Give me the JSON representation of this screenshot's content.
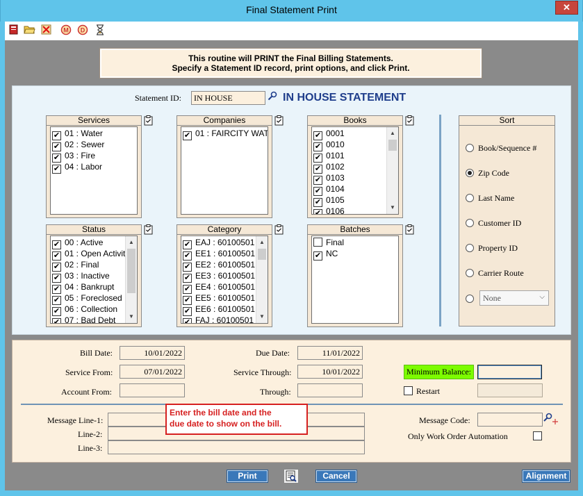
{
  "window": {
    "title": "Final Statement Print",
    "close_label": "✕"
  },
  "toolbar": {
    "icons": [
      "print-icon",
      "open-folder-icon",
      "delete-icon",
      "m-circle-icon",
      "d-circle-icon",
      "hourglass-icon"
    ]
  },
  "info": {
    "line1": "This routine will PRINT the Final Billing Statements.",
    "line2": "Specify a Statement ID record, print options, and click Print."
  },
  "statement": {
    "label": "Statement ID:",
    "value": "IN HOUSE",
    "description": "IN HOUSE STATEMENT"
  },
  "services": {
    "title": "Services",
    "items": [
      {
        "label": "01 : Water",
        "checked": true
      },
      {
        "label": "02 : Sewer",
        "checked": true
      },
      {
        "label": "03 : Fire",
        "checked": true
      },
      {
        "label": "04 : Labor",
        "checked": true
      }
    ]
  },
  "companies": {
    "title": "Companies",
    "items": [
      {
        "label": "01 : FAIRCITY WAT",
        "checked": true
      }
    ]
  },
  "books": {
    "title": "Books",
    "items": [
      {
        "label": "0001",
        "checked": true
      },
      {
        "label": "0010",
        "checked": true
      },
      {
        "label": "0101",
        "checked": true
      },
      {
        "label": "0102",
        "checked": true
      },
      {
        "label": "0103",
        "checked": true
      },
      {
        "label": "0104",
        "checked": true
      },
      {
        "label": "0105",
        "checked": true
      },
      {
        "label": "0106",
        "checked": true
      }
    ]
  },
  "status": {
    "title": "Status",
    "items": [
      {
        "label": "00 : Active",
        "checked": true
      },
      {
        "label": "01 : Open Activit",
        "checked": true
      },
      {
        "label": "02 : Final",
        "checked": true
      },
      {
        "label": "03 : Inactive",
        "checked": true
      },
      {
        "label": "04 : Bankrupt",
        "checked": true
      },
      {
        "label": "05 : Foreclosed",
        "checked": true
      },
      {
        "label": "06 : Collection",
        "checked": true
      },
      {
        "label": "07 : Bad Debt",
        "checked": true
      }
    ]
  },
  "category": {
    "title": "Category",
    "items": [
      {
        "label": "EAJ : 60100501",
        "checked": true
      },
      {
        "label": "EE1 : 60100501",
        "checked": true
      },
      {
        "label": "EE2 : 60100501",
        "checked": true
      },
      {
        "label": "EE3 : 60100501",
        "checked": true
      },
      {
        "label": "EE4 : 60100501",
        "checked": true
      },
      {
        "label": "EE5 : 60100501",
        "checked": true
      },
      {
        "label": "EE6 : 60100501",
        "checked": true
      },
      {
        "label": "FAJ : 60100501",
        "checked": true
      }
    ]
  },
  "batches": {
    "title": "Batches",
    "items": [
      {
        "label": "Final",
        "checked": false
      },
      {
        "label": "NC",
        "checked": true
      }
    ]
  },
  "sort": {
    "title": "Sort",
    "options": [
      {
        "label": "Book/Sequence #",
        "selected": false
      },
      {
        "label": "Zip Code",
        "selected": true
      },
      {
        "label": "Last Name",
        "selected": false
      },
      {
        "label": "Customer ID",
        "selected": false
      },
      {
        "label": "Property ID",
        "selected": false
      },
      {
        "label": "Carrier Route",
        "selected": false
      }
    ],
    "select_value": "None"
  },
  "form": {
    "bill_date_label": "Bill Date:",
    "bill_date": "10/01/2022",
    "due_date_label": "Due Date:",
    "due_date": "11/01/2022",
    "service_from_label": "Service From:",
    "service_from": "07/01/2022",
    "service_through_label": "Service Through:",
    "service_through": "10/01/2022",
    "account_from_label": "Account From:",
    "account_from": "",
    "through_label": "Through:",
    "through": "",
    "min_balance_label": "Minimum Balance:",
    "min_balance": "",
    "restart_label": "Restart",
    "restart_value": "",
    "message_line1_label": "Message Line-1:",
    "line2_label": "Line-2:",
    "line3_label": "Line-3:",
    "message_code_label": "Message Code:",
    "message_code": "",
    "work_order_label": "Only Work Order Automation"
  },
  "tooltip": {
    "line1": "Enter the bill date and the",
    "line2": "due date to show on the bill."
  },
  "buttons": {
    "print": "Print",
    "cancel": "Cancel",
    "alignment": "Alignment"
  },
  "colors": {
    "title_bar": "#5fc4ea",
    "accent_text": "#1f3e8c",
    "min_balance_highlight": "#7cfc00",
    "button": "#3a78b9",
    "tooltip_border": "#d62020"
  }
}
